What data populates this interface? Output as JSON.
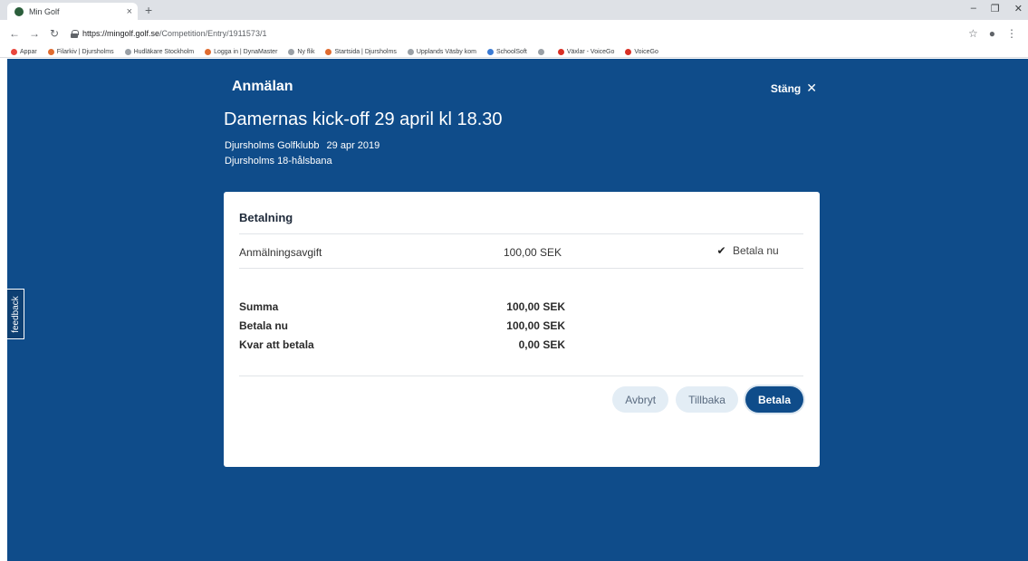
{
  "browser": {
    "tab_title": "Min Golf",
    "tab_close": "×",
    "new_tab": "+",
    "url_host": "https://mingolf.golf.se",
    "url_path": "/Competition/Entry/1911573/1",
    "bookmarks": [
      {
        "label": "Appar",
        "color": "#e8453c"
      },
      {
        "label": "Filarkiv | Djursholms",
        "color": "#e06c30"
      },
      {
        "label": "Hudläkare Stockholm",
        "color": "#9aa0a6"
      },
      {
        "label": "Logga in | DynaMaster",
        "color": "#e06c30"
      },
      {
        "label": "Ny flik",
        "color": "#9aa0a6"
      },
      {
        "label": "Startsida | Djursholms",
        "color": "#e06c30"
      },
      {
        "label": "Upplands Väsby kom",
        "color": "#9aa0a6"
      },
      {
        "label": "SchoolSoft",
        "color": "#3b7bd4"
      },
      {
        "label": "",
        "color": "#9aa0a6"
      },
      {
        "label": "Växlar - VoiceGo",
        "color": "#d93025"
      },
      {
        "label": "VoiceGo",
        "color": "#d93025"
      }
    ]
  },
  "page": {
    "title": "Anmälan",
    "close_label": "Stäng",
    "competition_name": "Damernas kick-off 29 april kl 18.30",
    "club": "Djursholms Golfklubb",
    "date": "29 apr 2019",
    "course": "Djursholms 18-hålsbana",
    "feedback_label": "feedback"
  },
  "payment": {
    "title": "Betalning",
    "fee_label": "Anmälningsavgift",
    "fee_amount": "100,00 SEK",
    "pay_now_label": "Betala nu",
    "pay_now_checked": true,
    "summary": [
      {
        "label": "Summa",
        "value": "100,00 SEK"
      },
      {
        "label": "Betala nu",
        "value": "100,00 SEK"
      },
      {
        "label": "Kvar att betala",
        "value": "0,00 SEK"
      }
    ],
    "buttons": {
      "cancel": "Avbryt",
      "back": "Tillbaka",
      "pay": "Betala"
    }
  },
  "colors": {
    "page_bg": "#0f4c8a",
    "primary_button": "#0f4c8a",
    "secondary_button": "#e3edf5"
  }
}
